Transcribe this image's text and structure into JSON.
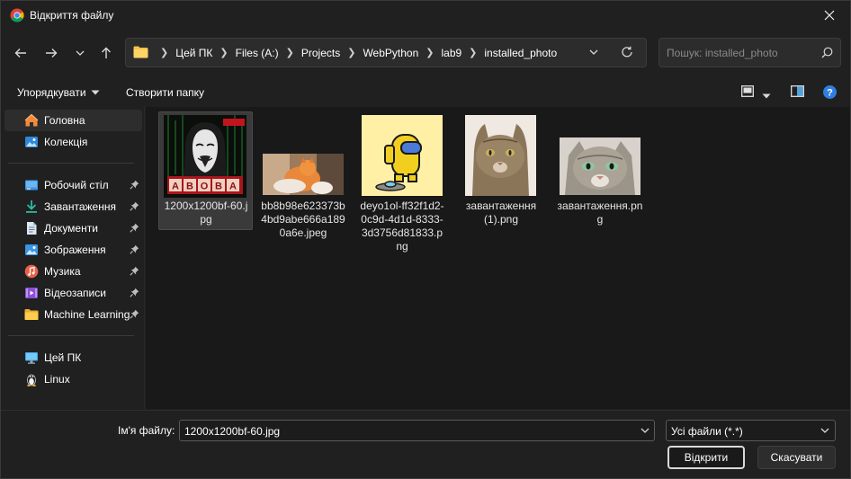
{
  "window": {
    "title": "Відкриття файлу"
  },
  "address_bar": {
    "crumbs": [
      "Цей ПК",
      "Files (A:)",
      "Projects",
      "WebPython",
      "lab9",
      "installed_photo"
    ]
  },
  "search": {
    "placeholder": "Пошук: installed_photo"
  },
  "command_bar": {
    "organize_label": "Упорядкувати",
    "new_folder_label": "Створити папку"
  },
  "sidebar": {
    "items": [
      {
        "label": "Головна",
        "icon": "home-icon"
      },
      {
        "label": "Колекція",
        "icon": "gallery-icon"
      },
      {
        "label": "Робочий стіл",
        "icon": "desktop-icon",
        "pinned": true
      },
      {
        "label": "Завантаження",
        "icon": "downloads-icon",
        "pinned": true
      },
      {
        "label": "Документи",
        "icon": "documents-icon",
        "pinned": true
      },
      {
        "label": "Зображення",
        "icon": "pictures-icon",
        "pinned": true
      },
      {
        "label": "Музика",
        "icon": "music-icon",
        "pinned": true
      },
      {
        "label": "Відеозаписи",
        "icon": "videos-icon",
        "pinned": true
      },
      {
        "label": "Machine Learning",
        "icon": "folder-icon",
        "pinned": true
      },
      {
        "label": "Цей ПК",
        "icon": "this-pc-icon"
      },
      {
        "label": "Linux",
        "icon": "linux-icon"
      }
    ]
  },
  "files": [
    {
      "name": "1200x1200bf-60.jpg",
      "thumb_text": "ABOBA"
    },
    {
      "name": "bb8b98e623373b4bd9abe666a1890a6e.jpeg"
    },
    {
      "name": "deyo1ol-ff32f1d2-0c9d-4d1d-8333-3d3756d81833.png"
    },
    {
      "name": "завантаження (1).png"
    },
    {
      "name": "завантаження.png"
    }
  ],
  "footer": {
    "filename_label": "Ім'я файлу:",
    "filename_value": "1200x1200bf-60.jpg",
    "filter_value": "Усі файли (*.*)",
    "open_label": "Відкрити",
    "cancel_label": "Скасувати"
  },
  "colors": {
    "background": "#202020",
    "content_bg": "#191919",
    "accent": "#0078d4",
    "folder": "#f3c24c"
  }
}
